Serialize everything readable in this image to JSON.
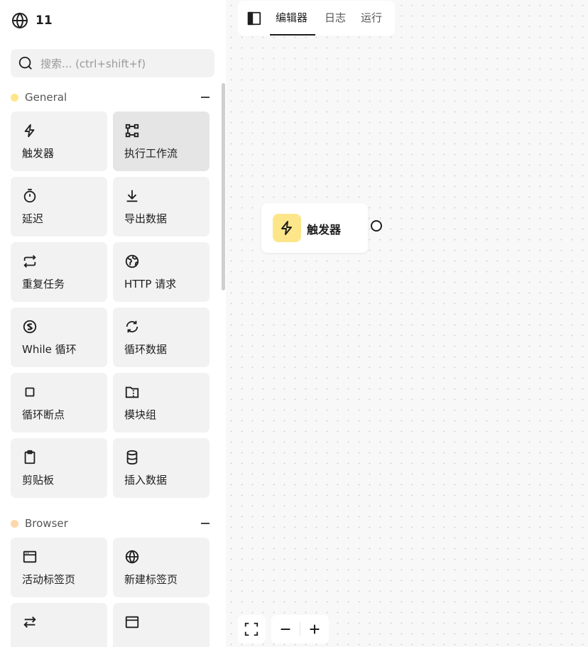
{
  "workflow": {
    "name": "11",
    "icon": "globe-icon"
  },
  "search": {
    "placeholder": "搜索... (ctrl+shift+f)"
  },
  "categories": [
    {
      "name": "General",
      "color": "#fde68a",
      "blocks": [
        {
          "label": "触发器",
          "icon": "lightning-icon"
        },
        {
          "label": "执行工作流",
          "icon": "flow-icon",
          "active": true
        },
        {
          "label": "延迟",
          "icon": "timer-icon"
        },
        {
          "label": "导出数据",
          "icon": "download-icon"
        },
        {
          "label": "重复任务",
          "icon": "repeat-icon"
        },
        {
          "label": "HTTP 请求",
          "icon": "earth-icon"
        },
        {
          "label": "While 循环",
          "icon": "while-loop-icon"
        },
        {
          "label": "循环数据",
          "icon": "refresh-icon"
        },
        {
          "label": "循环断点",
          "icon": "stop-icon"
        },
        {
          "label": "模块组",
          "icon": "folder-zip-icon"
        },
        {
          "label": "剪贴板",
          "icon": "clipboard-icon"
        },
        {
          "label": "插入数据",
          "icon": "database-icon"
        }
      ]
    },
    {
      "name": "Browser",
      "color": "#fed7aa",
      "blocks": [
        {
          "label": "活动标签页",
          "icon": "window-icon"
        },
        {
          "label": "新建标签页",
          "icon": "globe-icon"
        },
        {
          "label": "",
          "icon": "switch-arrows-icon"
        },
        {
          "label": "",
          "icon": "browser-window-icon"
        }
      ]
    }
  ],
  "tabs": {
    "editor": "编辑器",
    "logs": "日志",
    "running": "运行",
    "active": "editor"
  },
  "node": {
    "label": "触发器",
    "icon": "lightning-icon",
    "icon_color": "#fde68a"
  },
  "controls": {
    "fullscreen": "fullscreen-icon",
    "zoom_out": "minus-icon",
    "zoom_in": "plus-icon"
  }
}
